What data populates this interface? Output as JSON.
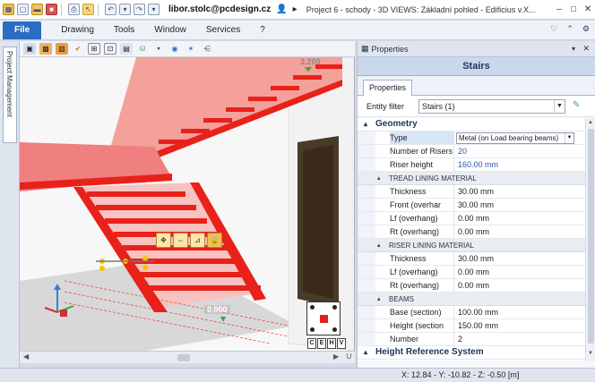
{
  "titlebar": {
    "user": "libor.stolc@pcdesign.cz",
    "title": "Project 6 - schody - 3D VIEWS: Základní pohled - Edificius v.X...",
    "window_buttons": [
      "–",
      "□",
      "✕"
    ]
  },
  "menubar": {
    "file": "File",
    "items": [
      "Drawing",
      "Tools",
      "Window",
      "Services",
      "?"
    ],
    "right_icons": [
      "♡",
      "⌃",
      "⚙"
    ]
  },
  "side_panel": {
    "tab_label": "Project Management"
  },
  "viewport": {
    "dimension_label": "0.000",
    "top_dimension": "3.200",
    "view_buttons": [
      "C",
      "E",
      "H",
      "V"
    ],
    "colors": {
      "stair": "#e8211a",
      "stair_light": "#f4a09b",
      "door": "#4a3a2a",
      "floor": "#d8d8d8"
    }
  },
  "properties": {
    "panel_title": "Properties",
    "object_title": "Stairs",
    "tab": "Properties",
    "entity_filter_label": "Entity filter",
    "entity_filter_value": "Stairs (1)",
    "sections": {
      "geometry": "Geometry",
      "tread": "TREAD LINING MATERIAL",
      "riser": "RISER LINING MATERIAL",
      "beams": "BEAMS",
      "height_ref": "Height Reference System"
    },
    "geometry_rows": [
      {
        "name": "Type",
        "value": "Metal (on Load bearing beams)"
      },
      {
        "name": "Number of Risers",
        "value": "20"
      },
      {
        "name": "Riser height",
        "value": "160.00 mm"
      }
    ],
    "tread_rows": [
      {
        "name": "Thickness",
        "value": "30.00 mm"
      },
      {
        "name": "Front (overhar",
        "value": "30.00 mm"
      },
      {
        "name": "Lf (overhang)",
        "value": "0.00 mm"
      },
      {
        "name": "Rt (overhang)",
        "value": "0.00 mm"
      }
    ],
    "riser_rows": [
      {
        "name": "Thickness",
        "value": "30.00 mm"
      },
      {
        "name": "Lf (overhang)",
        "value": "0.00 mm"
      },
      {
        "name": "Rt (overhang)",
        "value": "0.00 mm"
      }
    ],
    "beams_rows": [
      {
        "name": "Base (section)",
        "value": "100.00 mm"
      },
      {
        "name": "Height (section",
        "value": "150.00 mm"
      },
      {
        "name": "Number",
        "value": "2"
      }
    ]
  },
  "statusbar": {
    "coords": "X: 12.84 - Y: -10.82 - Z: -0.50 [m]"
  }
}
